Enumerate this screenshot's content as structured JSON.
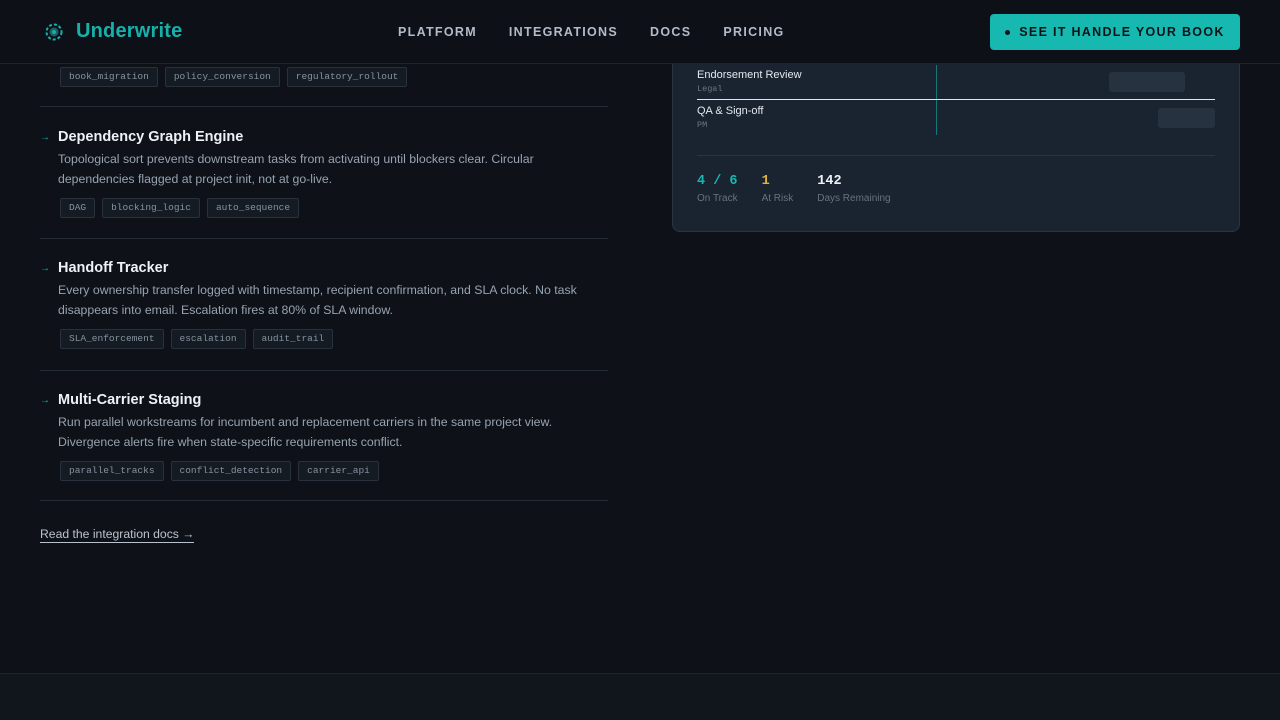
{
  "header": {
    "brand": "Underwrite",
    "nav": [
      "PLATFORM",
      "INTEGRATIONS",
      "DOCS",
      "PRICING"
    ],
    "cta_label": "SEE IT HANDLE YOUR BOOK"
  },
  "top_tags": [
    "book_migration",
    "policy_conversion",
    "regulatory_rollout"
  ],
  "features": [
    {
      "title": "Dependency Graph Engine",
      "desc": "Topological sort prevents downstream tasks from activating until blockers clear. Circular dependencies flagged at project init, not at go-live.",
      "tags": [
        "DAG",
        "blocking_logic",
        "auto_sequence"
      ]
    },
    {
      "title": "Handoff Tracker",
      "desc": "Every ownership transfer logged with timestamp, recipient confirmation, and SLA clock. No task disappears into email. Escalation fires at 80% of SLA window.",
      "tags": [
        "SLA_enforcement",
        "escalation",
        "audit_trail"
      ]
    },
    {
      "title": "Multi-Carrier Staging",
      "desc": "Run parallel workstreams for incumbent and replacement carriers in the same project view. Divergence alerts fire when state-specific requirements conflict.",
      "tags": [
        "parallel_tracks",
        "conflict_detection",
        "carrier_api"
      ]
    }
  ],
  "read_link": "Read the integration docs →",
  "card": {
    "rows": [
      {
        "name": "Endorsement Review",
        "role": "Legal"
      },
      {
        "name": "QA & Sign-off",
        "role": "PM"
      }
    ],
    "stats": [
      {
        "value": "4 / 6",
        "label": "On Track",
        "color": "#17b8b0"
      },
      {
        "value": "1",
        "label": "At Risk",
        "color": "#e3b341"
      },
      {
        "value": "142",
        "label": "Days Remaining",
        "color": "#eef2f6"
      }
    ]
  },
  "colors": {
    "accent": "#17b8b0",
    "warning": "#e3b341",
    "background": "#0e1218"
  }
}
